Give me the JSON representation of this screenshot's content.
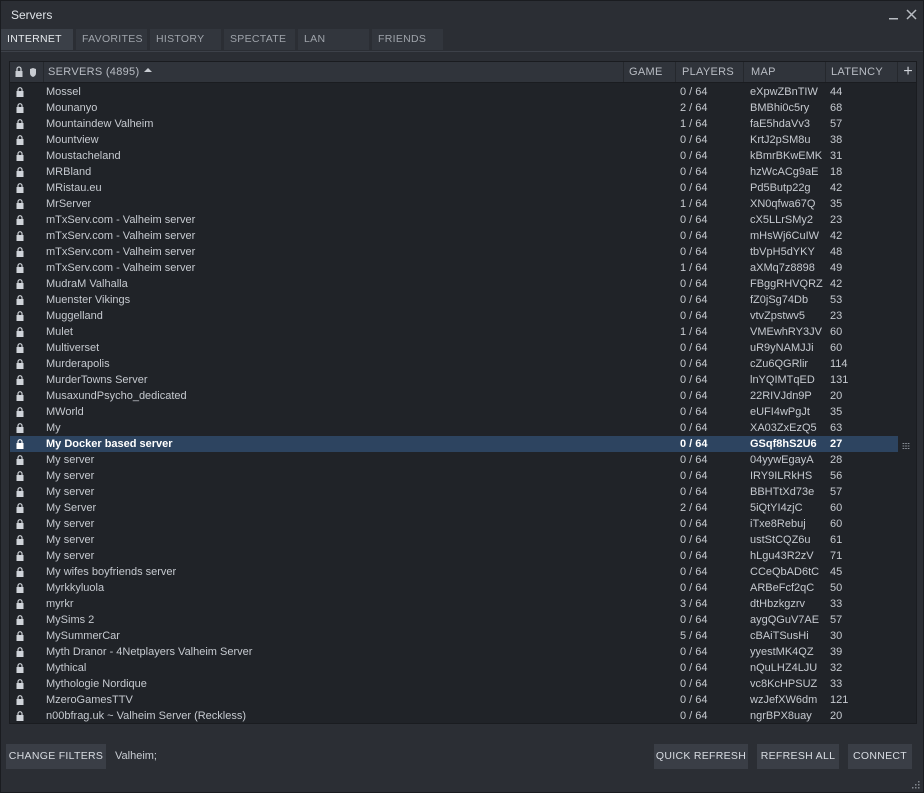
{
  "window": {
    "title": "Servers"
  },
  "tabs": [
    {
      "label": "INTERNET",
      "active": true
    },
    {
      "label": "FAVORITES",
      "active": false
    },
    {
      "label": "HISTORY",
      "active": false
    },
    {
      "label": "SPECTATE",
      "active": false
    },
    {
      "label": "LAN",
      "active": false
    },
    {
      "label": "FRIENDS",
      "active": false
    }
  ],
  "columns": {
    "servers": "SERVERS (4895)",
    "game": "GAME",
    "players": "PLAYERS",
    "map": "MAP",
    "latency": "LATENCY",
    "add": "+"
  },
  "rows": [
    {
      "name": "Mossel",
      "players": "0 / 64",
      "map": "eXpwZBnTIW",
      "latency": "44"
    },
    {
      "name": "Mounanyo",
      "players": "2 / 64",
      "map": "BMBhi0c5ry",
      "latency": "68"
    },
    {
      "name": "Mountaindew Valheim",
      "players": "1 / 64",
      "map": "faE5hdaVv3",
      "latency": "57"
    },
    {
      "name": "Mountview",
      "players": "0 / 64",
      "map": "KrtJ2pSM8u",
      "latency": "38"
    },
    {
      "name": "Moustacheland",
      "players": "0 / 64",
      "map": "kBmrBKwEMK",
      "latency": "31"
    },
    {
      "name": "MRBland",
      "players": "0 / 64",
      "map": "hzWcACg9aE",
      "latency": "18"
    },
    {
      "name": "MRistau.eu",
      "players": "0 / 64",
      "map": "Pd5Butp22g",
      "latency": "42"
    },
    {
      "name": "MrServer",
      "players": "1 / 64",
      "map": "XN0qfwa67Q",
      "latency": "35"
    },
    {
      "name": "mTxServ.com - Valheim server",
      "players": "0 / 64",
      "map": "cX5LLrSMy2",
      "latency": "23"
    },
    {
      "name": "mTxServ.com - Valheim server",
      "players": "0 / 64",
      "map": "mHsWj6CuIW",
      "latency": "42"
    },
    {
      "name": "mTxServ.com - Valheim server",
      "players": "0 / 64",
      "map": "tbVpH5dYKY",
      "latency": "48"
    },
    {
      "name": "mTxServ.com - Valheim server",
      "players": "1 / 64",
      "map": "aXMq7z8898",
      "latency": "49"
    },
    {
      "name": "MudraM Valhalla",
      "players": "0 / 64",
      "map": "FBggRHVQRZ",
      "latency": "42"
    },
    {
      "name": "Muenster Vikings",
      "players": "0 / 64",
      "map": "fZ0jSg74Db",
      "latency": "53"
    },
    {
      "name": "Muggelland",
      "players": "0 / 64",
      "map": "vtvZpstwv5",
      "latency": "23"
    },
    {
      "name": "Mulet",
      "players": "1 / 64",
      "map": "VMEwhRY3JV",
      "latency": "60"
    },
    {
      "name": "Multiverset",
      "players": "0 / 64",
      "map": "uR9yNAMJJi",
      "latency": "60"
    },
    {
      "name": "Murderapolis",
      "players": "0 / 64",
      "map": "cZu6QGRlir",
      "latency": "114"
    },
    {
      "name": "MurderTowns Server",
      "players": "0 / 64",
      "map": "lnYQIMTqED",
      "latency": "131"
    },
    {
      "name": "MusaxundPsycho_dedicated",
      "players": "0 / 64",
      "map": "22RIVJdn9P",
      "latency": "20"
    },
    {
      "name": "MWorld",
      "players": "0 / 64",
      "map": "eUFI4wPgJt",
      "latency": "35"
    },
    {
      "name": "My",
      "players": "0 / 64",
      "map": "XA03ZxEzQ5",
      "latency": "63"
    },
    {
      "name": "My Docker based server",
      "players": "0 / 64",
      "map": "GSqf8hS2U6",
      "latency": "27",
      "selected": true
    },
    {
      "name": "My server",
      "players": "0 / 64",
      "map": "04yywEgayA",
      "latency": "28"
    },
    {
      "name": "My server",
      "players": "0 / 64",
      "map": "IRY9ILRkHS",
      "latency": "56"
    },
    {
      "name": "My server",
      "players": "0 / 64",
      "map": "BBHTtXd73e",
      "latency": "57"
    },
    {
      "name": "My Server",
      "players": "2 / 64",
      "map": "5iQtYI4zjC",
      "latency": "60"
    },
    {
      "name": "My server",
      "players": "0 / 64",
      "map": "iTxe8Rebuj",
      "latency": "60"
    },
    {
      "name": "My server",
      "players": "0 / 64",
      "map": "ustStCQZ6u",
      "latency": "61"
    },
    {
      "name": "My server",
      "players": "0 / 64",
      "map": "hLgu43R2zV",
      "latency": "71"
    },
    {
      "name": "My wifes boyfriends server",
      "players": "0 / 64",
      "map": "CCeQbAD6tC",
      "latency": "45"
    },
    {
      "name": "Myrkkyluola",
      "players": "0 / 64",
      "map": "ARBeFcf2qC",
      "latency": "50"
    },
    {
      "name": "myrkr",
      "players": "3 / 64",
      "map": "dtHbzkgzrv",
      "latency": "33"
    },
    {
      "name": "MySims 2",
      "players": "0 / 64",
      "map": "aygQGuV7AE",
      "latency": "57"
    },
    {
      "name": "MySummerCar",
      "players": "5 / 64",
      "map": "cBAiTSusHi",
      "latency": "30"
    },
    {
      "name": "Myth Dranor - 4Netplayers Valheim Server",
      "players": "0 / 64",
      "map": "yyestMK4QZ",
      "latency": "39"
    },
    {
      "name": "Mythical",
      "players": "0 / 64",
      "map": "nQuLHZ4LJU",
      "latency": "32"
    },
    {
      "name": "Mythologie Nordique",
      "players": "0 / 64",
      "map": "vc8KcHPSUZ",
      "latency": "33"
    },
    {
      "name": "MzeroGamesTTV",
      "players": "0 / 64",
      "map": "wzJefXW6dm",
      "latency": "121"
    },
    {
      "name": "n00bfrag.uk ~ Valheim Server (Reckless)",
      "players": "0 / 64",
      "map": "ngrBPX8uay",
      "latency": "20"
    }
  ],
  "footer": {
    "change_filters": "CHANGE FILTERS",
    "filter_text": "Valheim;",
    "quick_refresh": "QUICK REFRESH",
    "refresh_all": "REFRESH ALL",
    "connect": "CONNECT"
  }
}
